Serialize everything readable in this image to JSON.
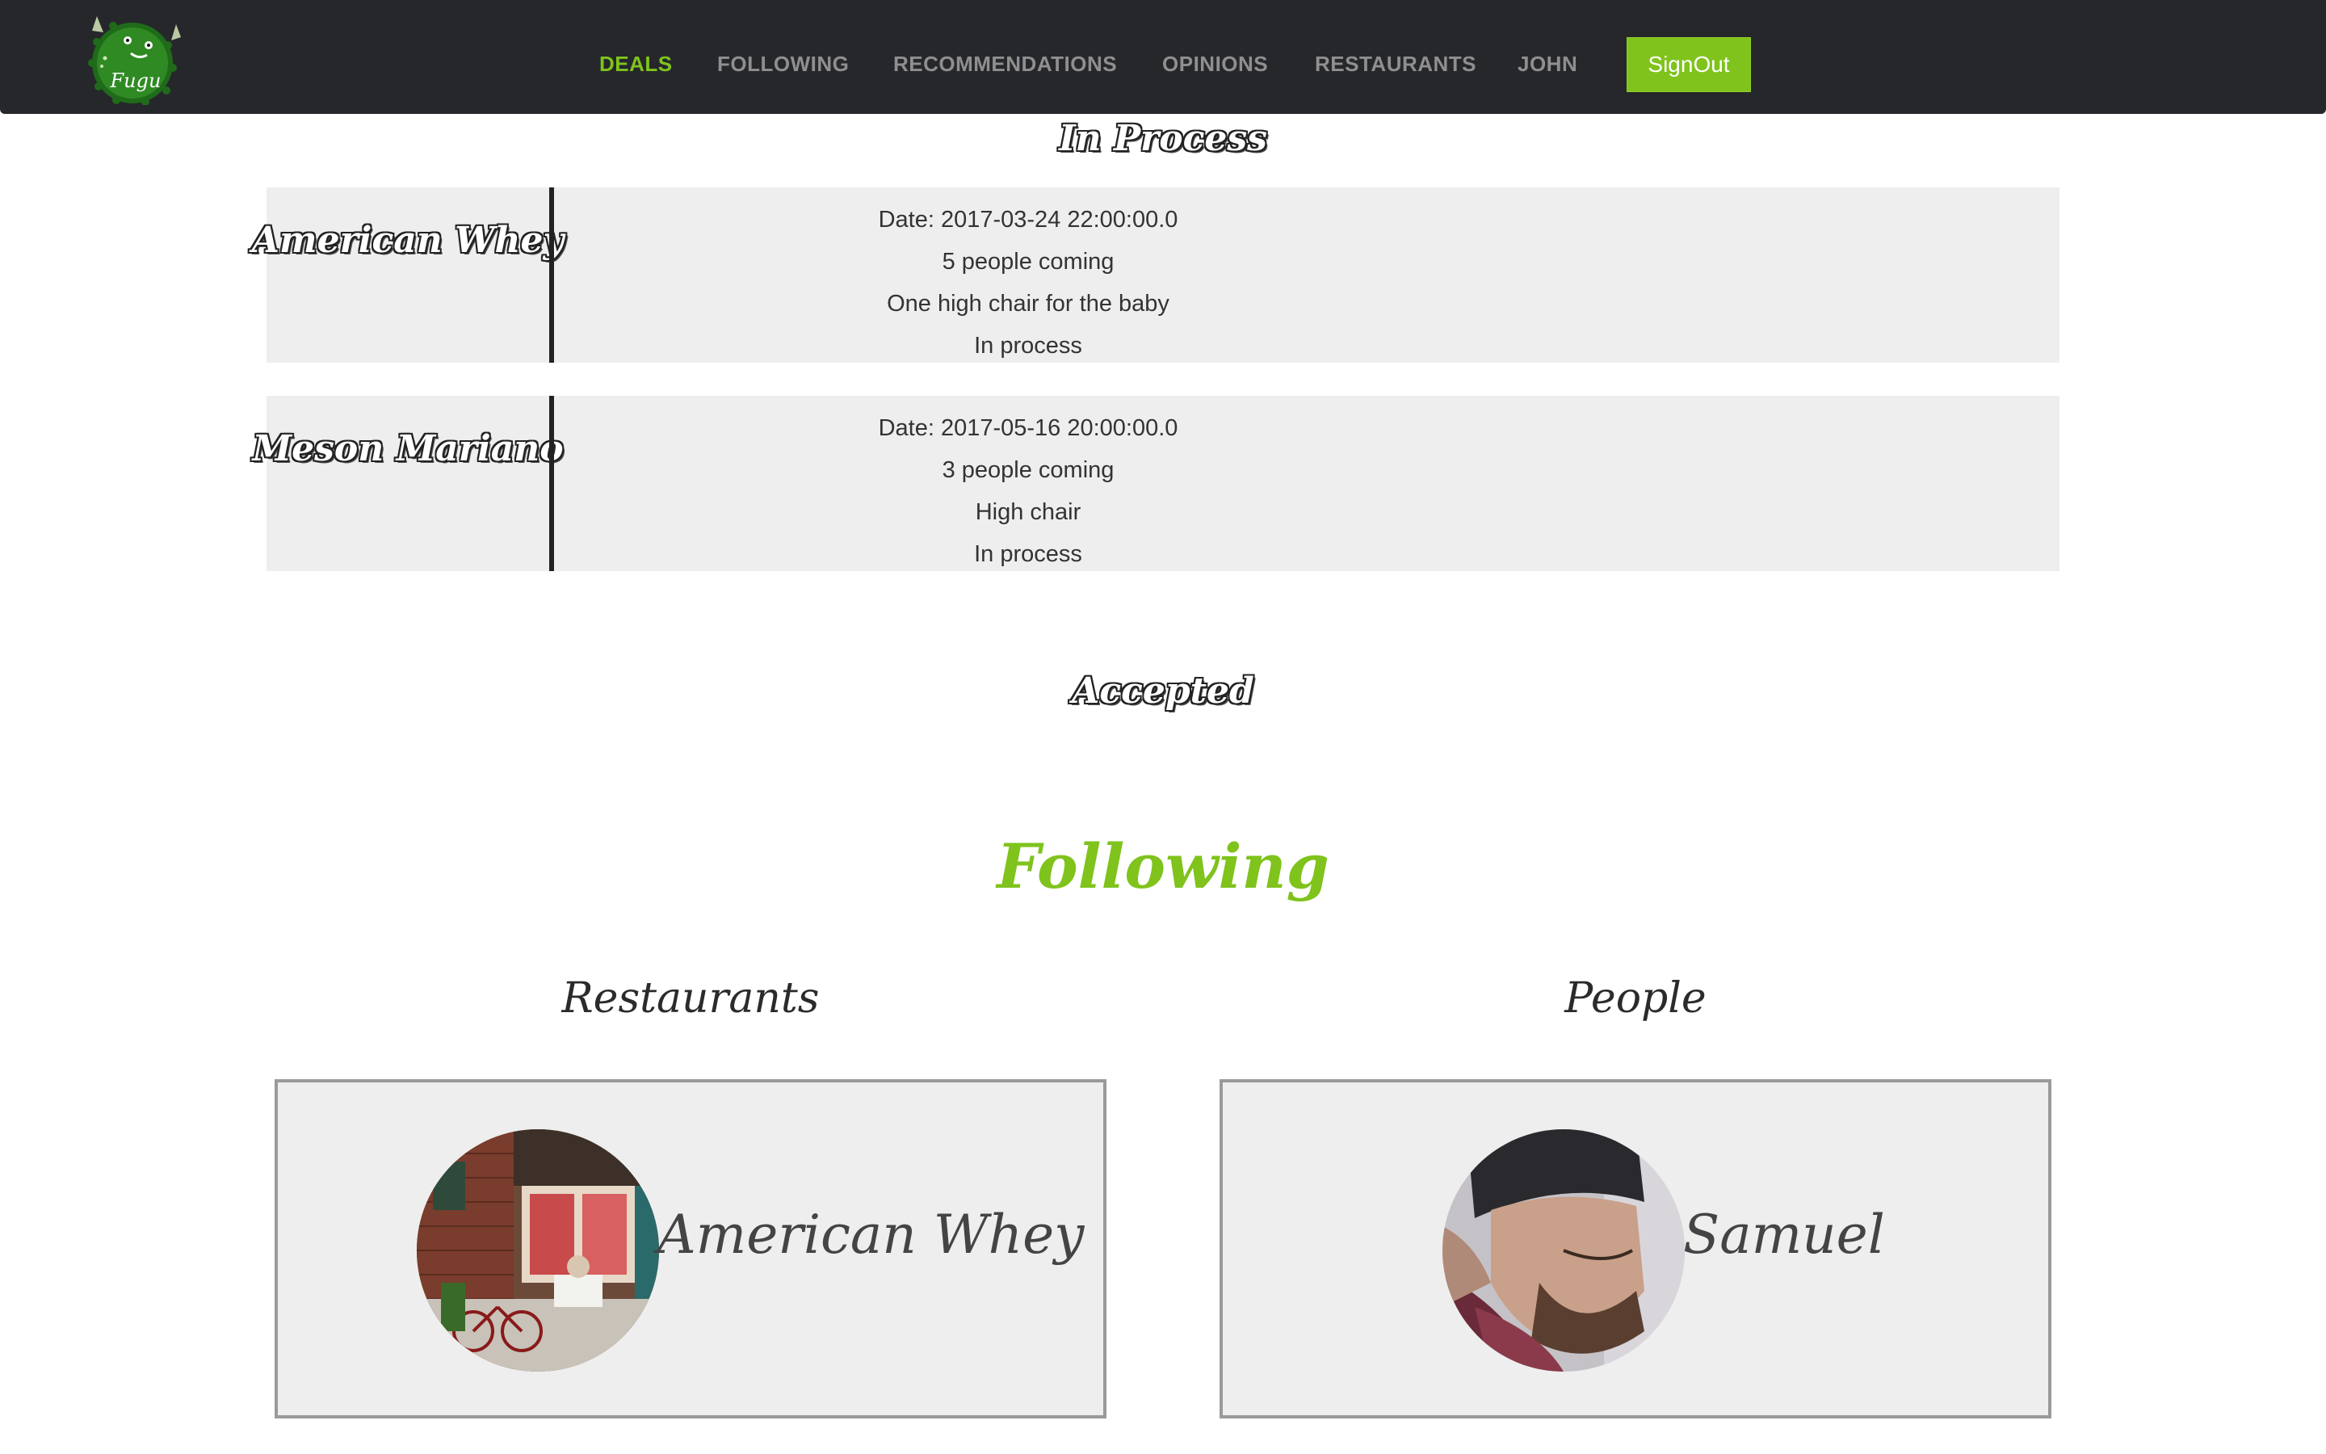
{
  "nav": {
    "items": [
      {
        "label": "DEALS",
        "active": true
      },
      {
        "label": "FOLLOWING",
        "active": false
      },
      {
        "label": "RECOMMENDATIONS",
        "active": false
      },
      {
        "label": "OPINIONS",
        "active": false
      },
      {
        "label": "RESTAURANTS",
        "active": false
      },
      {
        "label": "JOHN",
        "active": false
      }
    ],
    "signout_label": "SignOut",
    "logo_text": "Fugu"
  },
  "deals": {
    "in_process_heading": "In Process",
    "items": [
      {
        "restaurant": "American Whey",
        "date": "Date: 2017-03-24 22:00:00.0",
        "people": "5 people coming",
        "note": "One high chair for the baby",
        "status": "In process"
      },
      {
        "restaurant": "Meson Mariano",
        "date": "Date: 2017-05-16 20:00:00.0",
        "people": "3 people coming",
        "note": "High chair",
        "status": "In process"
      }
    ],
    "accepted_heading": "Accepted"
  },
  "following": {
    "title": "Following",
    "restaurants_title": "Restaurants",
    "people_title": "People",
    "restaurants": [
      {
        "name": "American Whey"
      }
    ],
    "people": [
      {
        "name": "Samuel"
      }
    ]
  },
  "colors": {
    "accent": "#7fc31c",
    "navbar": "#26272b",
    "card": "#eeeeee"
  }
}
